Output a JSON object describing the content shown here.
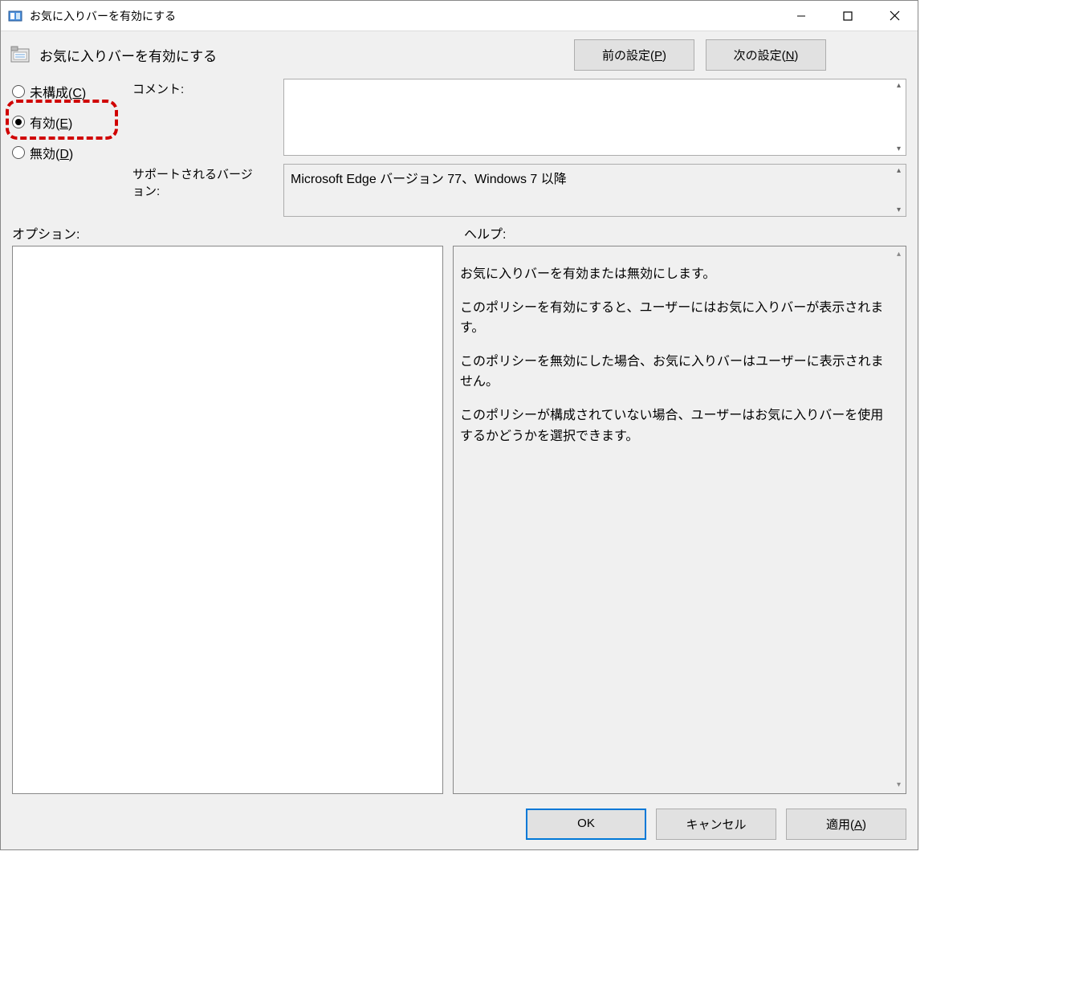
{
  "window": {
    "title": "お気に入りバーを有効にする"
  },
  "header": {
    "policy_title": "お気に入りバーを有効にする",
    "prev_setting": "前の設定(",
    "prev_setting_key": "P",
    "prev_setting_after": ")",
    "next_setting": "次の設定(",
    "next_setting_key": "N",
    "next_setting_after": ")"
  },
  "radios": {
    "not_configured": "未構成(",
    "not_configured_key": "C",
    "not_configured_after": ")",
    "enabled": "有効(",
    "enabled_key": "E",
    "enabled_after": ")",
    "disabled": "無効(",
    "disabled_key": "D",
    "disabled_after": ")",
    "selected": "enabled"
  },
  "fields": {
    "comment_label": "コメント:",
    "comment_value": "",
    "supported_label": "サポートされるバージョン:",
    "supported_value": "Microsoft Edge バージョン 77、Windows 7 以降"
  },
  "sections": {
    "options_label": "オプション:",
    "help_label": "ヘルプ:"
  },
  "help": {
    "p1": "お気に入りバーを有効または無効にします。",
    "p2": "このポリシーを有効にすると、ユーザーにはお気に入りバーが表示されます。",
    "p3": "このポリシーを無効にした場合、お気に入りバーはユーザーに表示されません。",
    "p4": "このポリシーが構成されていない場合、ユーザーはお気に入りバーを使用するかどうかを選択できます。"
  },
  "buttons": {
    "ok": "OK",
    "cancel": "キャンセル",
    "apply": "適用(",
    "apply_key": "A",
    "apply_after": ")"
  }
}
